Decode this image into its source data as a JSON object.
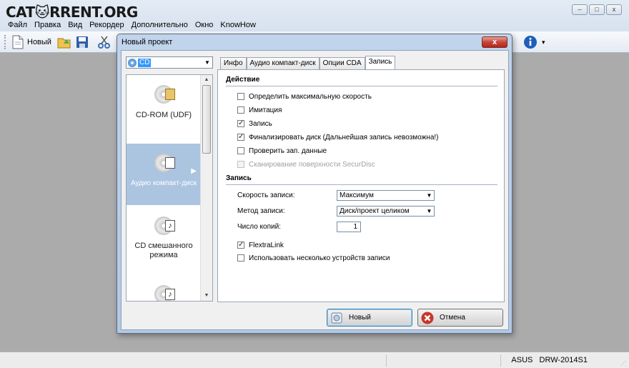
{
  "app": {
    "logo_text": "CAT🐱RRENT.ORG",
    "menu": [
      "Файл",
      "Правка",
      "Вид",
      "Рекордер",
      "Дополнительно",
      "Окно",
      "KnowHow"
    ],
    "toolbar": {
      "new_label": "Новый"
    },
    "window_controls": [
      "–",
      "□",
      "x"
    ]
  },
  "status_bar": {
    "drive_vendor": "ASUS",
    "drive_model": "DRW-2014S1"
  },
  "dialog": {
    "title": "Новый проект",
    "close_label": "x",
    "disc_type_select": {
      "value": "CD"
    },
    "project_list": [
      {
        "label": "CD-ROM (UDF)",
        "icon": "cd-rom-udf-icon",
        "selected": false
      },
      {
        "label": "Аудио компакт-диск",
        "icon": "audio-cd-icon",
        "selected": true
      },
      {
        "label": "CD смешанного режима",
        "icon": "mixed-mode-cd-icon",
        "selected": false
      },
      {
        "label": "",
        "icon": "music-cd-icon",
        "selected": false
      }
    ],
    "tabs": [
      {
        "label": "Инфо",
        "active": false
      },
      {
        "label": "Аудио компакт-диск",
        "active": false
      },
      {
        "label": "Опции CDA",
        "active": false
      },
      {
        "label": "Запись",
        "active": true
      }
    ],
    "action_group": {
      "header": "Действие",
      "options": [
        {
          "label": "Определить максимальную скорость",
          "checked": false,
          "enabled": true
        },
        {
          "label": "Имитация",
          "checked": false,
          "enabled": true
        },
        {
          "label": "Запись",
          "checked": true,
          "enabled": true
        },
        {
          "label": "Финализировать диск (Дальнейшая запись невозможна!)",
          "checked": true,
          "enabled": true
        },
        {
          "label": "Проверить зап. данные",
          "checked": false,
          "enabled": true
        },
        {
          "label": "Сканирование поверхности SecurDisc",
          "checked": false,
          "enabled": false
        }
      ]
    },
    "write_group": {
      "header": "Запись",
      "speed_label": "Скорость записи:",
      "speed_value": "Максимум",
      "method_label": "Метод записи:",
      "method_value": "Диск/проект целиком",
      "copies_label": "Число копий:",
      "copies_value": "1",
      "flextralink": {
        "label": "FlextraLink",
        "checked": true
      },
      "multi_recorders": {
        "label": "Использовать несколько устройств записи",
        "checked": false
      }
    },
    "buttons": {
      "new_label": "Новый",
      "cancel_label": "Отмена"
    }
  },
  "colors": {
    "selection": "#abc4e0",
    "dialog_frame": "#b9cde6",
    "workspace": "#ababab",
    "cancel_red": "#c8362b"
  }
}
